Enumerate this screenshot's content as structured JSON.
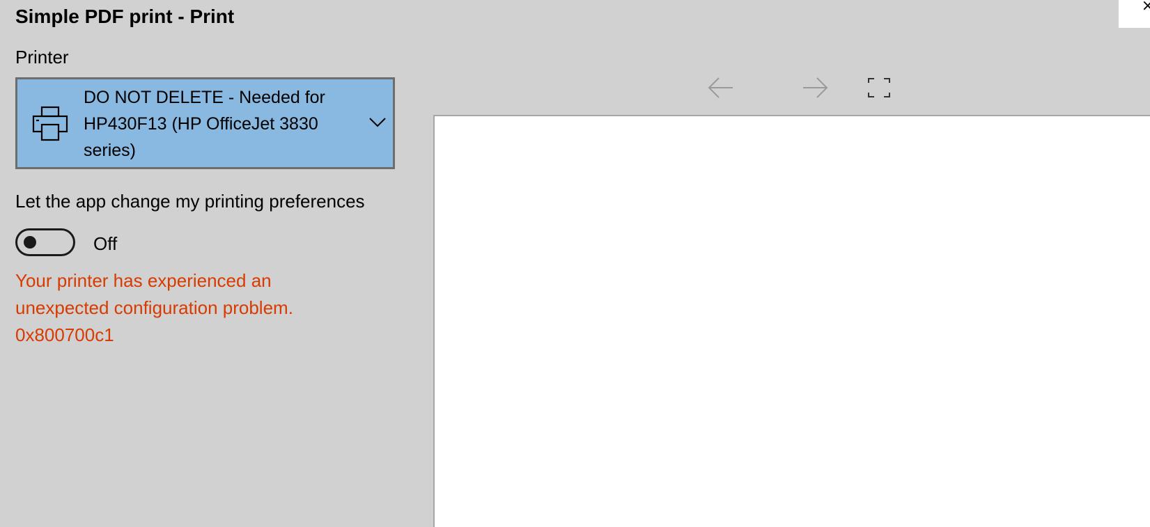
{
  "window": {
    "title": "Simple PDF print - Print",
    "close_icon": "close-icon"
  },
  "printer": {
    "label": "Printer",
    "selected_lines": [
      "DO NOT DELETE - Needed for",
      "HP430F13 (HP OfficeJet 3830",
      "series)"
    ],
    "icon": "printer-icon",
    "dropdown_icon": "chevron-down-icon"
  },
  "preferences": {
    "label": "Let the app change my printing preferences",
    "toggle_state": "Off"
  },
  "error": {
    "lines": [
      "Your printer has experienced an",
      "unexpected configuration problem.",
      "0x800700c1"
    ],
    "color": "#d83b01"
  },
  "preview_nav": {
    "prev_icon": "arrow-left-icon",
    "next_icon": "arrow-right-icon",
    "fit_icon": "fit-to-page-icon"
  },
  "colors": {
    "background": "#d1d1d1",
    "select_background": "#89b8e0",
    "select_border": "#6d6d6d"
  }
}
